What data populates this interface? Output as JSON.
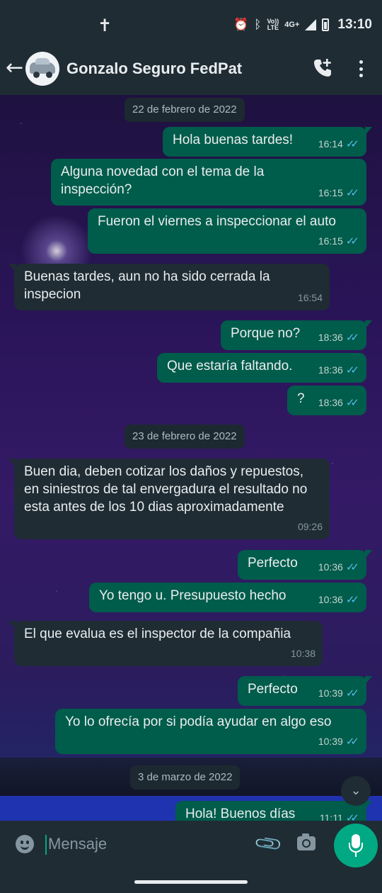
{
  "status_bar": {
    "time": "13:10",
    "volte_top": "Vo))",
    "volte_bottom": "LTE",
    "network": "4G+",
    "icons": [
      "cross-icon",
      "alarm-icon",
      "bluetooth-icon",
      "volte-icon",
      "signal-icon",
      "battery-icon"
    ]
  },
  "header": {
    "contact_name": "Gonzalo Seguro FedPat",
    "icons": [
      "back-icon",
      "avatar",
      "add-call-icon",
      "more-options-icon"
    ]
  },
  "messages": [
    {
      "type": "date",
      "text": "22 de febrero de 2022"
    },
    {
      "type": "out",
      "text": "Hola buenas tardes!",
      "time": "16:14",
      "ticks": "✓✓"
    },
    {
      "type": "out",
      "text": "Alguna novedad con el tema de la inspección?",
      "time": "16:15",
      "ticks": "✓✓"
    },
    {
      "type": "out",
      "text": "Fueron el viernes a inspeccionar el auto",
      "time": "16:15",
      "ticks": "✓✓"
    },
    {
      "type": "in",
      "text": "Buenas tardes, aun no ha sido cerrada la inspecion",
      "time": "16:54"
    },
    {
      "type": "out",
      "text": "Porque no?",
      "time": "18:36",
      "ticks": "✓✓"
    },
    {
      "type": "out",
      "text": "Que estaría faltando.",
      "time": "18:36",
      "ticks": "✓✓"
    },
    {
      "type": "out",
      "text": "?",
      "time": "18:36",
      "ticks": "✓✓"
    },
    {
      "type": "date",
      "text": "23 de febrero de 2022"
    },
    {
      "type": "in",
      "text": "Buen dia, deben cotizar los daños y repuestos, en siniestros de tal envergadura el resultado no esta antes de los 10 dias aproximadamente",
      "time": "09:26"
    },
    {
      "type": "out",
      "text": "Perfecto",
      "time": "10:36",
      "ticks": "✓✓"
    },
    {
      "type": "out",
      "text": "Yo tengo u. Presupuesto hecho",
      "time": "10:36",
      "ticks": "✓✓"
    },
    {
      "type": "in",
      "text": "El que evalua es el inspector de la compañia",
      "time": "10:38"
    },
    {
      "type": "out",
      "text": "Perfecto",
      "time": "10:39",
      "ticks": "✓✓"
    },
    {
      "type": "out",
      "text": "Yo lo ofrecía por si podía ayudar en algo eso",
      "time": "10:39",
      "ticks": "✓✓"
    },
    {
      "type": "date",
      "text": "3 de marzo de 2022"
    },
    {
      "type": "out",
      "text": "Hola! Buenos días",
      "time": "11:11",
      "ticks": "✓✓"
    }
  ],
  "input": {
    "placeholder": "Mensaje",
    "icons": [
      "emoji-icon",
      "attach-icon",
      "camera-icon",
      "mic-icon",
      "scroll-down-icon"
    ]
  },
  "colors": {
    "outgoing_bubble": "#005c4b",
    "incoming_bubble": "#1f2c34",
    "accent": "#00a884",
    "read_ticks": "#53bdeb"
  }
}
